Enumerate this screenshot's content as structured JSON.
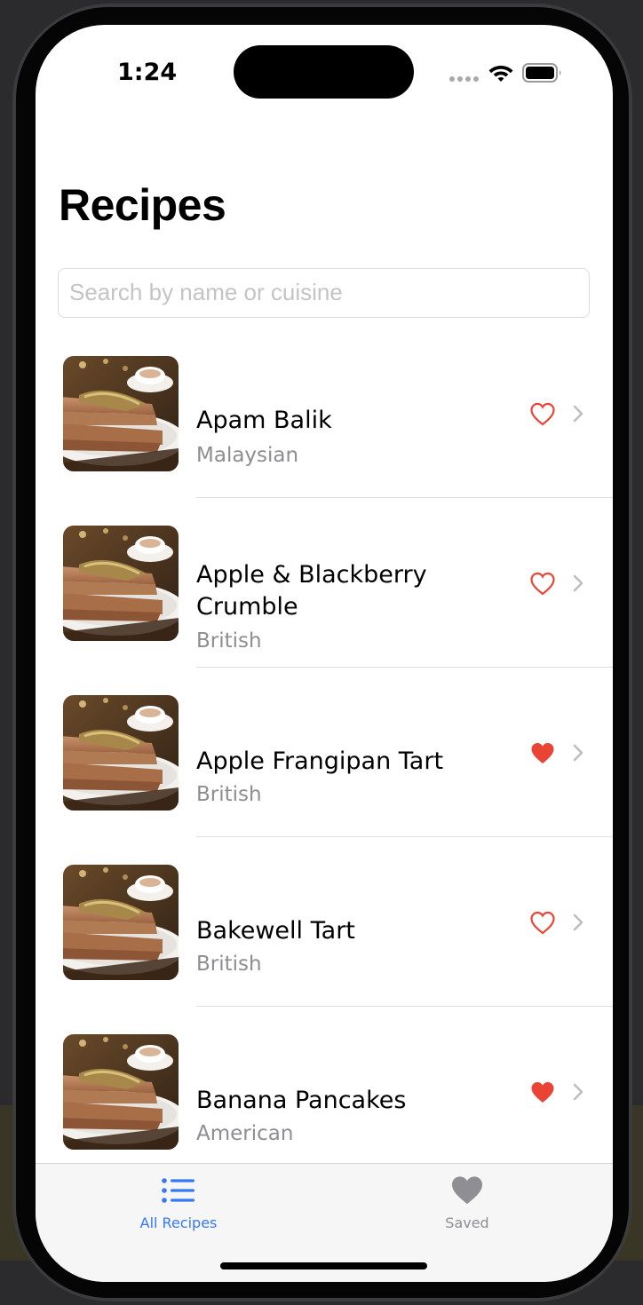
{
  "status_bar": {
    "time": "1:24"
  },
  "page_title": "Recipes",
  "search": {
    "placeholder": "Search by name or cuisine",
    "value": ""
  },
  "recipes": [
    {
      "name": "Apam Balik",
      "cuisine": "Malaysian",
      "saved": false
    },
    {
      "name": "Apple & Blackberry Crumble",
      "cuisine": "British",
      "saved": false
    },
    {
      "name": "Apple Frangipan Tart",
      "cuisine": "British",
      "saved": true
    },
    {
      "name": "Bakewell Tart",
      "cuisine": "British",
      "saved": false
    },
    {
      "name": "Banana Pancakes",
      "cuisine": "American",
      "saved": true
    }
  ],
  "tab_bar": {
    "tabs": [
      {
        "label": "All Recipes",
        "icon": "list-icon",
        "active": true
      },
      {
        "label": "Saved",
        "icon": "heart-icon",
        "active": false
      }
    ]
  },
  "colors": {
    "accent": "#3478f6",
    "heart": "#ea4435",
    "secondary_text": "#8d8d92",
    "inactive_tab": "#8e8e93"
  }
}
